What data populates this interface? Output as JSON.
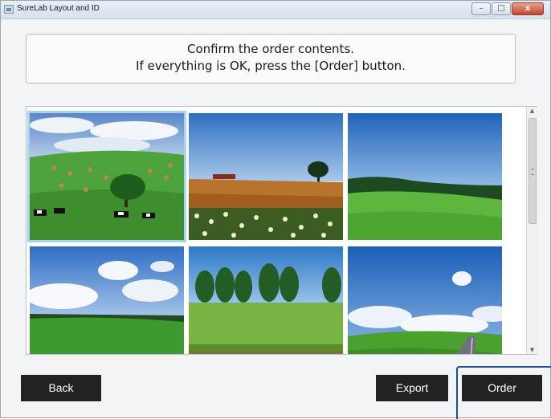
{
  "window": {
    "title": "SureLab Layout and ID",
    "controls": {
      "minimize": "–",
      "maximize": "□",
      "close": "x"
    }
  },
  "message": {
    "line1": "Confirm the order contents.",
    "line2": "If everything is OK, press the [Order] button."
  },
  "gallery": {
    "photos": [
      {
        "name": "field-with-hay-bales-and-cows",
        "selected": true
      },
      {
        "name": "wheat-field-with-tree"
      },
      {
        "name": "green-hill-with-forest"
      },
      {
        "name": "meadow-with-clouds"
      },
      {
        "name": "field-with-tree-row"
      },
      {
        "name": "hills-with-road-and-clouds"
      }
    ]
  },
  "scrollbar": {
    "up": "▲",
    "down": "▼"
  },
  "buttons": {
    "back": "Back",
    "export": "Export",
    "order": "Order"
  },
  "colors": {
    "button_bg": "#222222",
    "selection": "#a9d3ee",
    "highlight": "#1d4f8c"
  }
}
